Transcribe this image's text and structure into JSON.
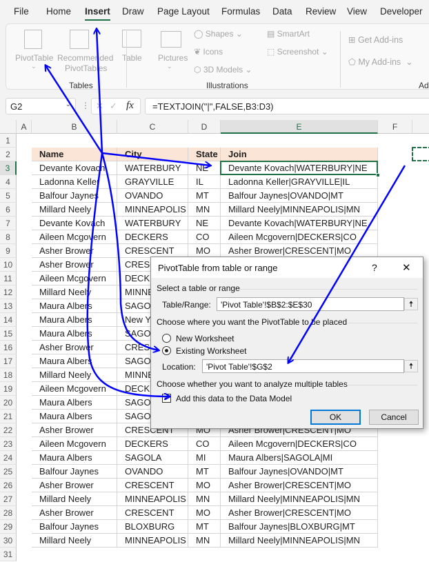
{
  "menu": {
    "tabs": [
      "File",
      "Home",
      "Insert",
      "Draw",
      "Page Layout",
      "Formulas",
      "Data",
      "Review",
      "View",
      "Developer"
    ],
    "active": "Insert"
  },
  "ribbon": {
    "tables": {
      "pivottable": "PivotTable",
      "recommended_1": "Recommended",
      "recommended_2": "PivotTables",
      "table": "Table",
      "group": "Tables"
    },
    "illustrations": {
      "pictures": "Pictures",
      "shapes": "Shapes",
      "icons": "Icons",
      "models": "3D Models",
      "smartart": "SmartArt",
      "screenshot": "Screenshot",
      "group": "Illustrations"
    },
    "addins": {
      "get": "Get Add-ins",
      "my": "My Add-ins",
      "group": "Add"
    }
  },
  "formula_bar": {
    "name_box": "G2",
    "fx": "fx",
    "formula": "=TEXTJOIN(\"|\",FALSE,B3:D3)"
  },
  "columns": [
    "A",
    "B",
    "C",
    "D",
    "E",
    "F"
  ],
  "rows": [
    "1",
    "2",
    "3",
    "4",
    "5",
    "6",
    "7",
    "8",
    "9",
    "10",
    "11",
    "12",
    "13",
    "14",
    "15",
    "16",
    "17",
    "18",
    "19",
    "20",
    "21",
    "22",
    "23",
    "24",
    "25",
    "26",
    "27",
    "28",
    "29",
    "30",
    "31"
  ],
  "table": {
    "headers": [
      "Name",
      "City",
      "State",
      "Join"
    ],
    "data": [
      [
        "Devante Kovach",
        "WATERBURY",
        "NE",
        "Devante Kovach|WATERBURY|NE"
      ],
      [
        "Ladonna Keller",
        "GRAYVILLE",
        "IL",
        "Ladonna Keller|GRAYVILLE|IL"
      ],
      [
        "Balfour Jaynes",
        "OVANDO",
        "MT",
        "Balfour Jaynes|OVANDO|MT"
      ],
      [
        "Millard Neely",
        "MINNEAPOLIS",
        "MN",
        "Millard Neely|MINNEAPOLIS|MN"
      ],
      [
        "Devante Kovach",
        "WATERBURY",
        "NE",
        "Devante Kovach|WATERBURY|NE"
      ],
      [
        "Aileen Mcgovern",
        "DECKERS",
        "CO",
        "Aileen Mcgovern|DECKERS|CO"
      ],
      [
        "Asher Brower",
        "CRESCENT",
        "MO",
        "Asher Brower|CRESCENT|MO"
      ],
      [
        "Asher Brower",
        "CRESC",
        "",
        ""
      ],
      [
        "Aileen Mcgovern",
        "DECKE",
        "",
        ""
      ],
      [
        "Millard Neely",
        "MINNE",
        "",
        ""
      ],
      [
        "Maura Albers",
        "SAGOL",
        "",
        ""
      ],
      [
        "Maura Albers",
        "New Y",
        "",
        ""
      ],
      [
        "Maura Albers",
        "SAGOL",
        "",
        ""
      ],
      [
        "Asher Brower",
        "CRESC",
        "",
        ""
      ],
      [
        "Maura Albers",
        "SAGOL",
        "",
        ""
      ],
      [
        "Millard Neely",
        "MINNE",
        "",
        ""
      ],
      [
        "Aileen Mcgovern",
        "DECKE",
        "",
        ""
      ],
      [
        "Maura Albers",
        "SAGOL",
        "",
        ""
      ],
      [
        "Maura Albers",
        "SAGOL",
        "",
        ""
      ],
      [
        "Asher Brower",
        "CRESCENT",
        "MO",
        "Asher Brower|CRESCENT|MO"
      ],
      [
        "Aileen Mcgovern",
        "DECKERS",
        "CO",
        "Aileen Mcgovern|DECKERS|CO"
      ],
      [
        "Maura Albers",
        "SAGOLA",
        "MI",
        "Maura Albers|SAGOLA|MI"
      ],
      [
        "Balfour Jaynes",
        "OVANDO",
        "MT",
        "Balfour Jaynes|OVANDO|MT"
      ],
      [
        "Asher Brower",
        "CRESCENT",
        "MO",
        "Asher Brower|CRESCENT|MO"
      ],
      [
        "Millard Neely",
        "MINNEAPOLIS",
        "MN",
        "Millard Neely|MINNEAPOLIS|MN"
      ],
      [
        "Asher Brower",
        "CRESCENT",
        "MO",
        "Asher Brower|CRESCENT|MO"
      ],
      [
        "Balfour Jaynes",
        "BLOXBURG",
        "MT",
        "Balfour Jaynes|BLOXBURG|MT"
      ],
      [
        "Millard Neely",
        "MINNEAPOLIS",
        "MN",
        "Millard Neely|MINNEAPOLIS|MN"
      ]
    ]
  },
  "dialog": {
    "title": "PivotTable from table or range",
    "help": "?",
    "close": "✕",
    "section_select": "Select a table or range",
    "range_label": "Table/Range:",
    "range_value": "'Pivot Table'!$B$2:$E$30",
    "section_place": "Choose where you want the PivotTable to be placed",
    "new_ws": "New Worksheet",
    "existing_ws": "Existing Worksheet",
    "placement_selected": "Existing Worksheet",
    "location_label": "Location:",
    "location_value": "'Pivot Table'!$G$2",
    "section_multi": "Choose whether you want to analyze multiple tables",
    "data_model": "Add this data to the Data Model",
    "data_model_checked": true,
    "ok": "OK",
    "cancel": "Cancel",
    "collapse_icon": "🠅"
  },
  "colors": {
    "accent": "#1e7145",
    "header_fill": "#fbe5d6",
    "annotation": "#0000ff",
    "dialog_focus": "#0078d7"
  }
}
